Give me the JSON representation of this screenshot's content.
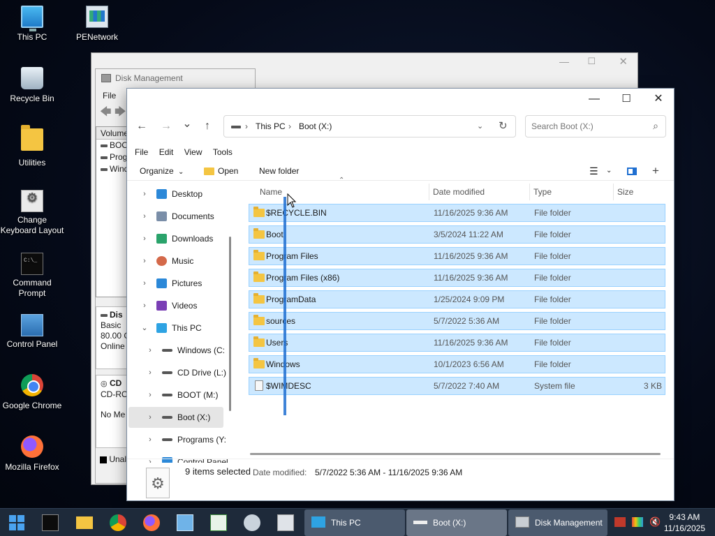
{
  "desktop": {
    "icons": [
      {
        "label": "This PC",
        "icon": "computer-icon"
      },
      {
        "label": "PENetwork",
        "icon": "network-icon"
      },
      {
        "label": "Recycle Bin",
        "icon": "recycle-bin-icon"
      },
      {
        "label": "Utilities",
        "icon": "folder-icon"
      },
      {
        "label": "Change Keyboard Layout",
        "icon": "keyboard-settings-icon"
      },
      {
        "label": "Command Prompt",
        "icon": "command-prompt-icon"
      },
      {
        "label": "Control Panel",
        "icon": "control-panel-icon"
      },
      {
        "label": "Google Chrome",
        "icon": "chrome-icon"
      },
      {
        "label": "Mozilla Firefox",
        "icon": "firefox-icon"
      }
    ]
  },
  "disk_management": {
    "title": "Disk Management",
    "menu_file": "File",
    "list_header": "Volume",
    "list_rows": [
      "BOO",
      "Prog",
      "Wind"
    ],
    "disk0": {
      "name": "Dis",
      "type": "Basic",
      "size": "80.00 G",
      "status": "Online"
    },
    "cdrom": {
      "name": "CD",
      "type": "CD-RO",
      "media": "No Me"
    },
    "legend_unallocated": "Unal"
  },
  "explorer": {
    "nav": {
      "back": "←",
      "forward": "→",
      "recent": "⌄",
      "up": "↑"
    },
    "breadcrumb": {
      "item1": "This PC",
      "item2": "Boot (X:)",
      "sep": "›"
    },
    "search": {
      "placeholder": "Search Boot (X:)"
    },
    "menu": {
      "file": "File",
      "edit": "Edit",
      "view": "View",
      "tools": "Tools"
    },
    "command": {
      "organize": "Organize",
      "open": "Open",
      "new_folder": "New folder"
    },
    "sidebar": [
      {
        "label": "Desktop",
        "icon": "desktop-icon",
        "color": "#2b88d8"
      },
      {
        "label": "Documents",
        "icon": "documents-icon",
        "color": "#7a8ea8"
      },
      {
        "label": "Downloads",
        "icon": "downloads-icon",
        "color": "#2aa36b"
      },
      {
        "label": "Music",
        "icon": "music-icon",
        "color": "#d4694a"
      },
      {
        "label": "Pictures",
        "icon": "pictures-icon",
        "color": "#2b88d8"
      },
      {
        "label": "Videos",
        "icon": "videos-icon",
        "color": "#7a3fb5"
      },
      {
        "label": "This PC",
        "icon": "computer-icon",
        "color": "#2ea3e3"
      },
      {
        "label": "Windows (C:",
        "icon": "drive-icon",
        "color": "#555555"
      },
      {
        "label": "CD Drive (L:)",
        "icon": "cd-drive-icon",
        "color": "#555555"
      },
      {
        "label": "BOOT (M:)",
        "icon": "drive-icon",
        "color": "#555555"
      },
      {
        "label": "Boot (X:)",
        "icon": "drive-icon",
        "color": "#555555"
      },
      {
        "label": "Programs (Y:",
        "icon": "drive-icon",
        "color": "#555555"
      },
      {
        "label": "Control Panel",
        "icon": "control-panel-icon",
        "color": "#2b88d8"
      }
    ],
    "columns": {
      "name": "Name",
      "date": "Date modified",
      "type": "Type",
      "size": "Size"
    },
    "files": [
      {
        "name": "$RECYCLE.BIN",
        "date": "11/16/2025 9:36 AM",
        "type": "File folder",
        "size": "",
        "kind": "folder"
      },
      {
        "name": "Boot",
        "date": "3/5/2024 11:22 AM",
        "type": "File folder",
        "size": "",
        "kind": "folder"
      },
      {
        "name": "Program Files",
        "date": "11/16/2025 9:36 AM",
        "type": "File folder",
        "size": "",
        "kind": "folder"
      },
      {
        "name": "Program Files (x86)",
        "date": "11/16/2025 9:36 AM",
        "type": "File folder",
        "size": "",
        "kind": "folder"
      },
      {
        "name": "ProgramData",
        "date": "1/25/2024 9:09 PM",
        "type": "File folder",
        "size": "",
        "kind": "folder"
      },
      {
        "name": "sources",
        "date": "5/7/2022 5:36 AM",
        "type": "File folder",
        "size": "",
        "kind": "folder"
      },
      {
        "name": "Users",
        "date": "11/16/2025 9:36 AM",
        "type": "File folder",
        "size": "",
        "kind": "folder"
      },
      {
        "name": "Windows",
        "date": "10/1/2023 6:56 AM",
        "type": "File folder",
        "size": "",
        "kind": "folder"
      },
      {
        "name": "$WIMDESC",
        "date": "5/7/2022 7:40 AM",
        "type": "System file",
        "size": "3 KB",
        "kind": "file"
      }
    ],
    "status": {
      "selected": "9 items selected",
      "date_label": "Date modified:",
      "date_range": "5/7/2022 5:36 AM - 11/16/2025 9:36 AM"
    }
  },
  "taskbar": {
    "apps": {
      "this_pc": "This PC",
      "boot_x": "Boot (X:)",
      "disk_management": "Disk Management"
    },
    "clock": {
      "time": "9:43 AM",
      "date": "11/16/2025"
    }
  },
  "colors": {
    "selection_fill": "#cce8ff",
    "selection_border": "#99d1ff",
    "taskbar": "#1e2a3a",
    "accent": "#1f6fd1"
  }
}
